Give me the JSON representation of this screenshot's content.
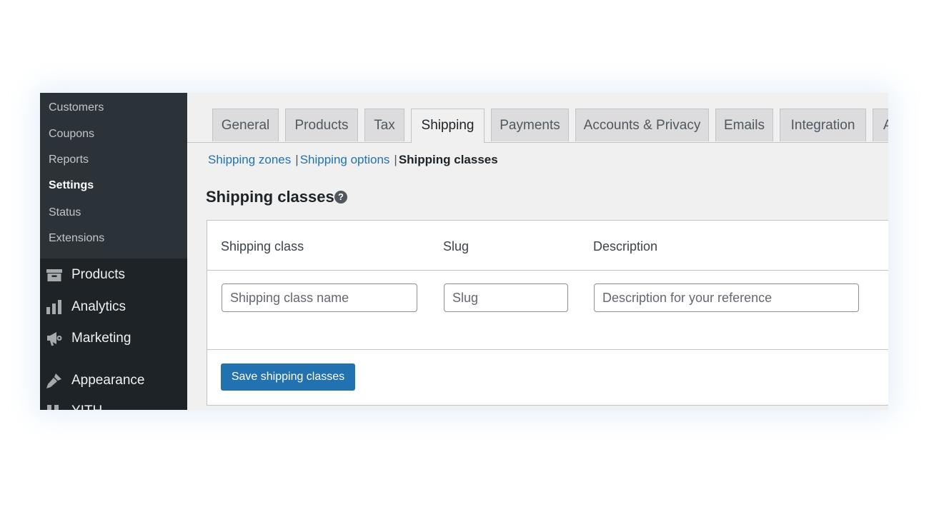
{
  "sidebar": {
    "submenu": [
      {
        "label": "Customers",
        "active": false
      },
      {
        "label": "Coupons",
        "active": false
      },
      {
        "label": "Reports",
        "active": false
      },
      {
        "label": "Settings",
        "active": true
      },
      {
        "label": "Status",
        "active": false
      },
      {
        "label": "Extensions",
        "active": false
      }
    ],
    "menu": [
      {
        "label": "Products",
        "icon": "archive-icon"
      },
      {
        "label": "Analytics",
        "icon": "bar-chart-icon"
      },
      {
        "label": "Marketing",
        "icon": "megaphone-icon"
      },
      {
        "label": "Appearance",
        "icon": "paintbrush-icon"
      },
      {
        "label": "YITH",
        "icon": "yith-icon"
      }
    ]
  },
  "tabs": [
    {
      "label": "General",
      "active": false
    },
    {
      "label": "Products",
      "active": false
    },
    {
      "label": "Tax",
      "active": false
    },
    {
      "label": "Shipping",
      "active": true
    },
    {
      "label": "Payments",
      "active": false
    },
    {
      "label": "Accounts & Privacy",
      "active": false
    },
    {
      "label": "Emails",
      "active": false
    },
    {
      "label": "Integration",
      "active": false
    },
    {
      "label": "Advanced",
      "active": false
    }
  ],
  "subnav": {
    "links": [
      "Shipping zones",
      "Shipping options"
    ],
    "separator": "|",
    "current": "Shipping classes"
  },
  "page": {
    "heading": "Shipping classes",
    "help_glyph": "?"
  },
  "table": {
    "headers": {
      "class": "Shipping class",
      "slug": "Slug",
      "description": "Description"
    },
    "placeholders": {
      "class": "Shipping class name",
      "slug": "Slug",
      "description": "Description for your reference"
    },
    "values": {
      "class": "",
      "slug": "",
      "description": ""
    }
  },
  "actions": {
    "save_label": "Save shipping classes"
  },
  "colors": {
    "sidebar_bg": "#1d2327",
    "submenu_bg": "#2c3338",
    "accent": "#2271b1",
    "link": "#2271b1",
    "page_bg": "#f0f0f1"
  }
}
